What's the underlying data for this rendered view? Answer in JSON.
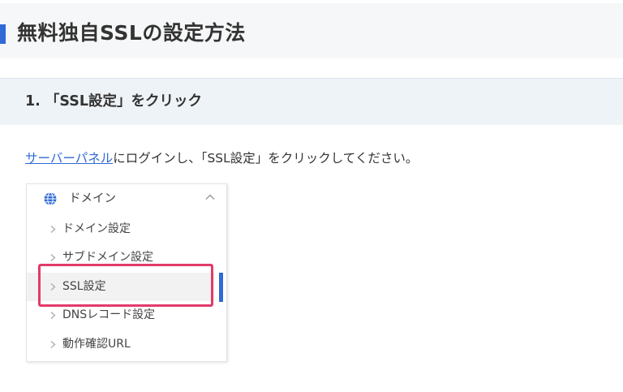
{
  "page": {
    "title": "無料独自SSLの設定方法"
  },
  "step": {
    "title": "1. 「SSL設定」をクリック"
  },
  "intro": {
    "link_text": "サーバーパネル",
    "rest_text": "にログインし、「SSL設定」をクリックしてください。"
  },
  "menu": {
    "header_label": "ドメイン",
    "header_icon": "globe-icon",
    "items": [
      {
        "label": "ドメイン設定"
      },
      {
        "label": "サブドメイン設定"
      },
      {
        "label": "SSL設定",
        "active": true
      },
      {
        "label": "DNSレコード設定"
      },
      {
        "label": "動作確認URL"
      }
    ]
  },
  "colors": {
    "accent": "#2f6ad6",
    "highlight": "#e23a6a",
    "header_bg": "#f6f7f8",
    "step_bg": "#eef3f7"
  }
}
